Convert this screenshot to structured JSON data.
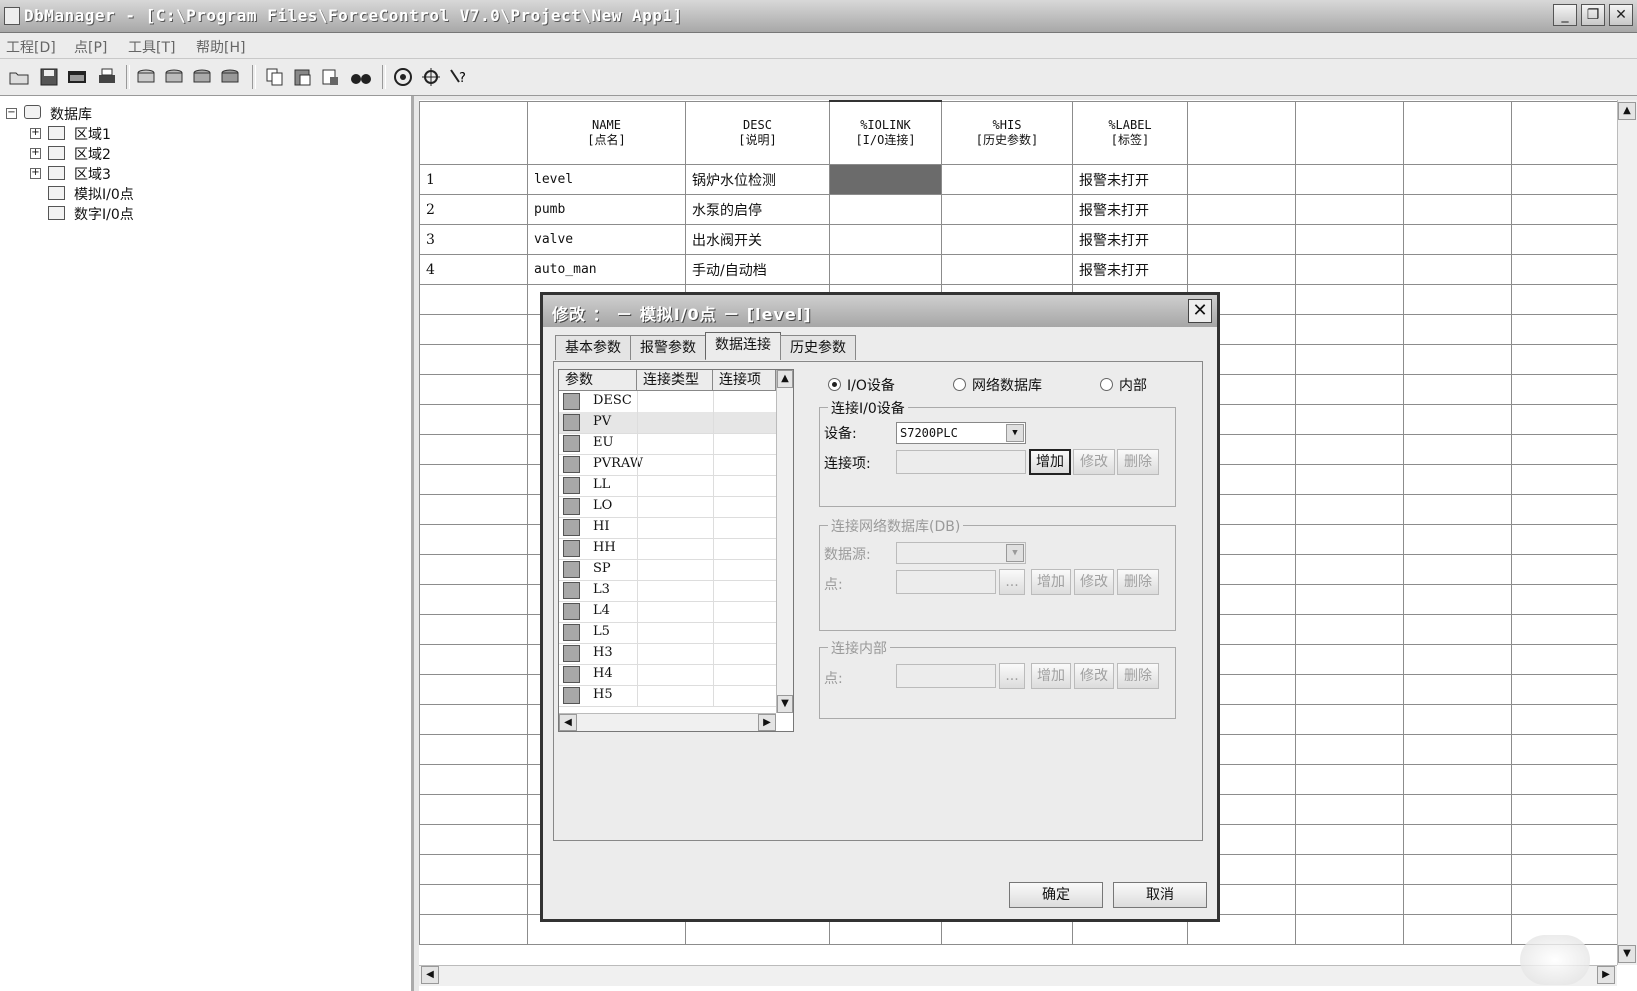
{
  "window": {
    "title": "DbManager - [C:\\Program Files\\ForceControl V7.0\\Project\\New App1]",
    "minimize": "_",
    "restore": "❐",
    "close": "✕"
  },
  "menu": [
    "工程[D]",
    "点[P]",
    "工具[T]",
    "帮助[H]"
  ],
  "toolbar_icons": [
    "open-folder-icon",
    "save-icon",
    "window-icon",
    "print-icon",
    "add-db-icon",
    "edit-db-icon",
    "delete-db-icon",
    "db-settings-icon",
    "copy-icon",
    "paste-icon",
    "export-icon",
    "find-binoculars-icon",
    "target-icon",
    "crosshair-icon",
    "help-icon"
  ],
  "tree": {
    "root": "数据库",
    "items": [
      "区域1",
      "区域2",
      "区域3",
      "模拟I/0点",
      "数字I/0点"
    ]
  },
  "grid": {
    "headers": [
      {
        "top": "NAME",
        "bottom": "[点名]"
      },
      {
        "top": "DESC",
        "bottom": "[说明]"
      },
      {
        "top": "%IOLINK",
        "bottom": "[I/O连接]"
      },
      {
        "top": "%HIS",
        "bottom": "[历史参数]"
      },
      {
        "top": "%LABEL",
        "bottom": "[标签]"
      }
    ],
    "rows": [
      {
        "num": "1",
        "name": "level",
        "desc": "锅炉水位检测",
        "label": "报警未打开"
      },
      {
        "num": "2",
        "name": "pumb",
        "desc": "水泵的启停",
        "label": "报警未打开"
      },
      {
        "num": "3",
        "name": "valve",
        "desc": "出水阀开关",
        "label": "报警未打开"
      },
      {
        "num": "4",
        "name": "auto_man",
        "desc": "手动/自动档",
        "label": "报警未打开"
      }
    ]
  },
  "dialog": {
    "title": "修改 ： － 模拟I/0点 － [level]",
    "close": "✕",
    "tabs": [
      "基本参数",
      "报警参数",
      "数据连接",
      "历史参数"
    ],
    "active_tab": "数据连接",
    "param_list": {
      "headers": [
        "参数",
        "连接类型",
        "连接项"
      ],
      "params": [
        "DESC",
        "PV",
        "EU",
        "PVRAW",
        "LL",
        "LO",
        "HI",
        "HH",
        "SP",
        "L3",
        "L4",
        "L5",
        "H3",
        "H4",
        "H5"
      ],
      "selected": "PV"
    },
    "radios": {
      "io_device": "I/O设备",
      "network_db": "网络数据库",
      "internal": "内部",
      "selected": "io_device"
    },
    "group_io": {
      "title": "连接I/0设备",
      "device_label": "设备:",
      "device_value": "S7200PLC",
      "item_label": "连接项:",
      "item_value": "",
      "add": "增加",
      "edit": "修改",
      "delete": "删除"
    },
    "group_net": {
      "title": "连接网络数据库(DB)",
      "source_label": "数据源:",
      "point_label": "点:",
      "browse": "...",
      "add": "增加",
      "edit": "修改",
      "delete": "删除"
    },
    "group_internal": {
      "title": "连接内部",
      "point_label": "点:",
      "browse": "...",
      "add": "增加",
      "edit": "修改",
      "delete": "删除"
    },
    "ok": "确定",
    "cancel": "取消"
  }
}
